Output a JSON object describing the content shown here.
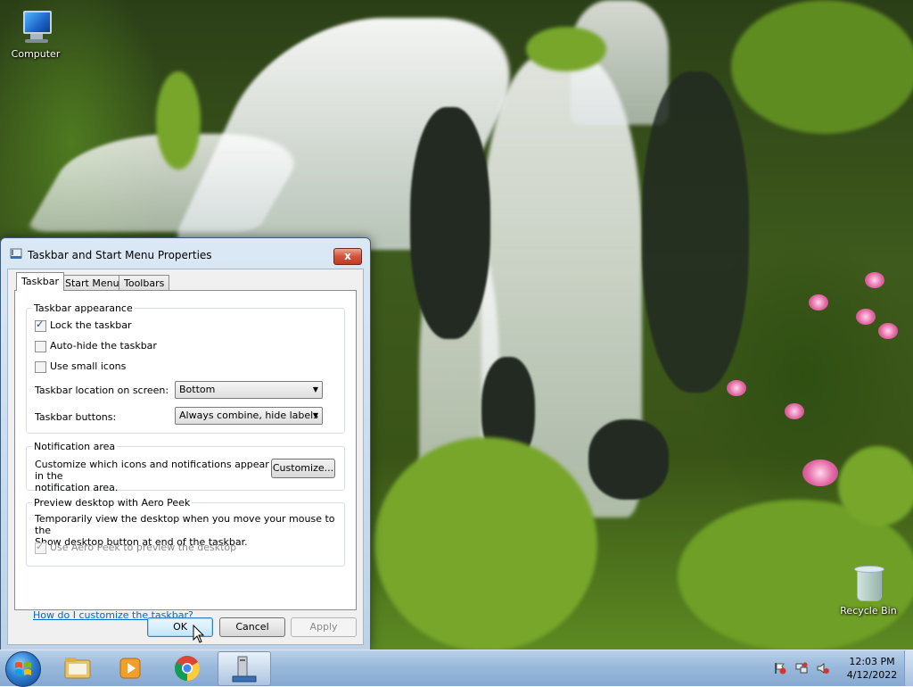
{
  "desktop": {
    "icons": [
      {
        "label": "Computer",
        "icon": "computer-icon"
      },
      {
        "label": "Recycle Bin",
        "icon": "recycle-bin-icon"
      }
    ]
  },
  "dialog": {
    "title": "Taskbar and Start Menu Properties",
    "close_glyph": "x",
    "tabs": [
      {
        "label": "Taskbar",
        "selected": true
      },
      {
        "label": "Start Menu",
        "selected": false
      },
      {
        "label": "Toolbars",
        "selected": false
      }
    ],
    "appearance": {
      "title": "Taskbar appearance",
      "lock_label": "Lock the taskbar",
      "lock_checked": true,
      "autohide_label": "Auto-hide the taskbar",
      "autohide_checked": false,
      "small_icons_label": "Use small icons",
      "small_icons_checked": false,
      "location_label": "Taskbar location on screen:",
      "location_value": "Bottom",
      "buttons_label": "Taskbar buttons:",
      "buttons_value": "Always combine, hide labels"
    },
    "notification": {
      "title": "Notification area",
      "description_line1": "Customize which icons and notifications appear in the",
      "description_line2": "notification area.",
      "customize_label": "Customize..."
    },
    "aero_peek": {
      "title": "Preview desktop with Aero Peek",
      "description_line1": "Temporarily view the desktop when you move your mouse to the",
      "description_line2": "Show desktop button at end of the taskbar.",
      "checkbox_label": "Use Aero Peek to preview the desktop",
      "checkbox_checked": true,
      "checkbox_disabled": true
    },
    "help_link": "How do I customize the taskbar?",
    "ok_label": "OK",
    "cancel_label": "Cancel",
    "apply_label": "Apply",
    "apply_disabled": true
  },
  "taskbar": {
    "start_icon": "windows-start-icon",
    "pinned": [
      {
        "icon": "file-explorer-icon"
      },
      {
        "icon": "media-player-icon"
      },
      {
        "icon": "chrome-icon"
      },
      {
        "icon": "control-panel-icon",
        "active": true
      }
    ],
    "tray_icons": [
      "action-center-flag-icon",
      "network-icon",
      "volume-muted-icon"
    ],
    "time": "12:03 PM",
    "date": "4/12/2022"
  },
  "colors": {
    "accent": "#0066cc",
    "taskbar": "#9ab9dc",
    "close_button": "#c23b23"
  }
}
